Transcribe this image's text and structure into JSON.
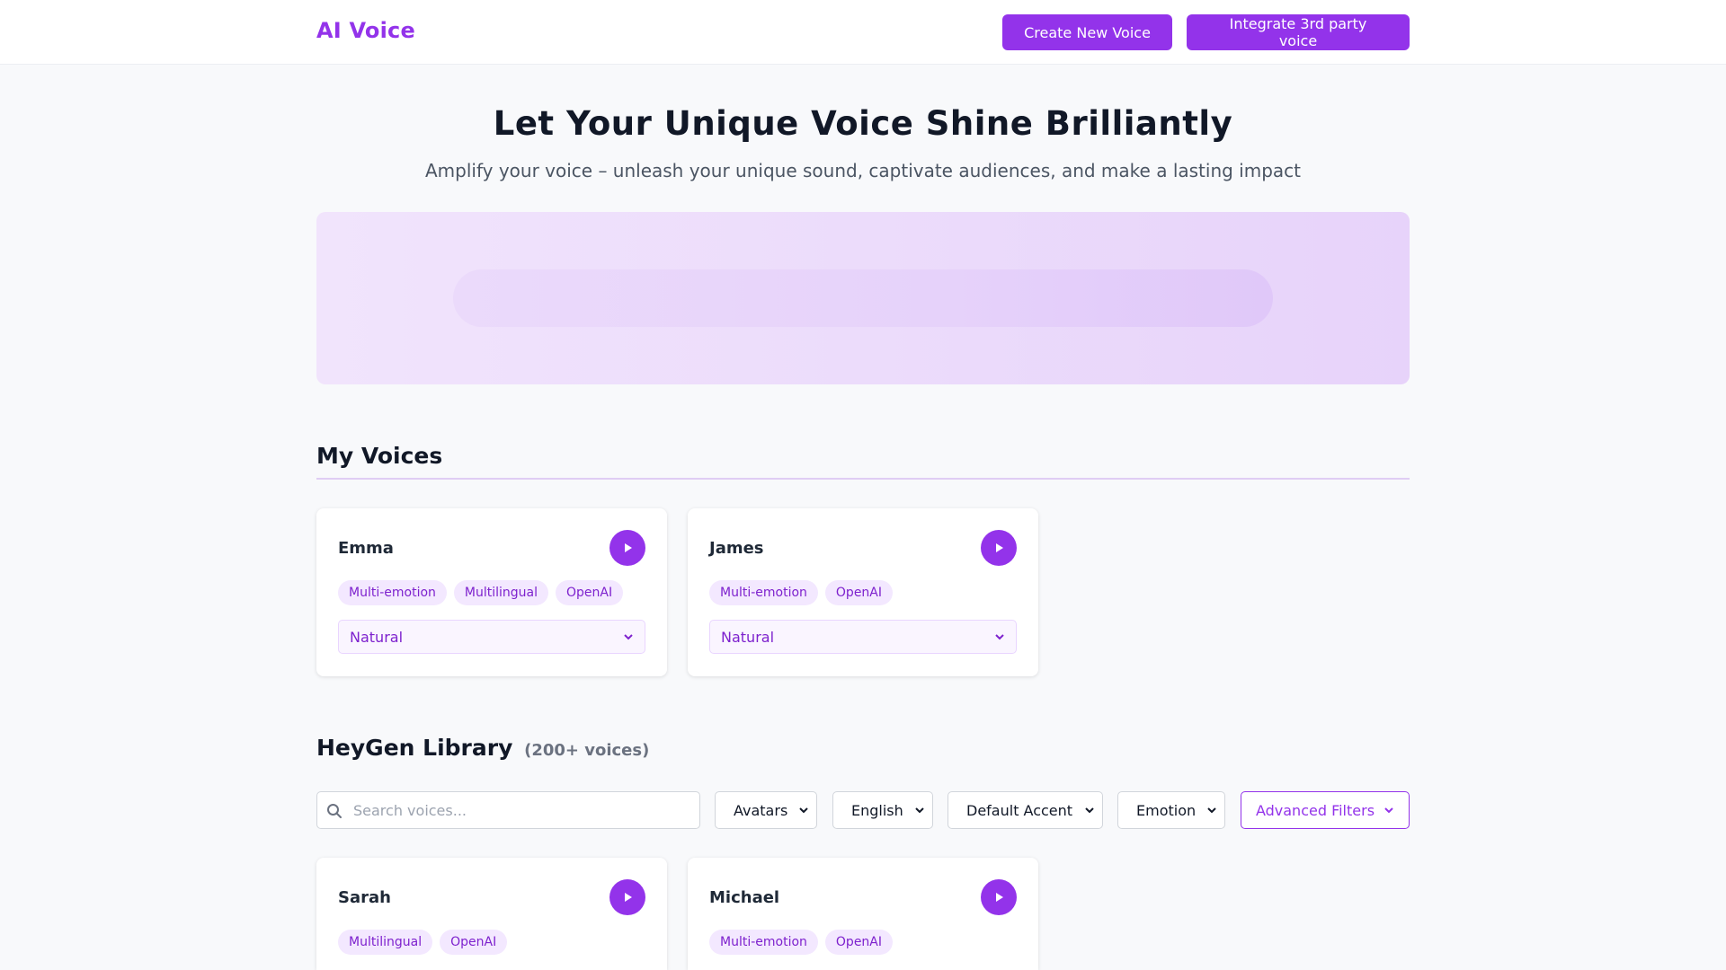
{
  "header": {
    "logo": "AI Voice",
    "create_button": "Create New Voice",
    "integrate_button": "Integrate 3rd party voice"
  },
  "hero": {
    "title": "Let Your Unique Voice Shine Brilliantly",
    "subtitle": "Amplify your voice – unleash your unique sound, captivate audiences, and make a lasting impact"
  },
  "my_voices": {
    "title": "My Voices",
    "cards": [
      {
        "name": "Emma",
        "tags": [
          "Multi-emotion",
          "Multilingual",
          "OpenAI"
        ],
        "style": "Natural"
      },
      {
        "name": "James",
        "tags": [
          "Multi-emotion",
          "OpenAI"
        ],
        "style": "Natural"
      }
    ]
  },
  "library": {
    "title": "HeyGen Library",
    "count": "(200+ voices)",
    "search_placeholder": "Search voices...",
    "filters": {
      "avatars": "Avatars",
      "language": "English",
      "accent": "Default Accent",
      "emotion": "Emotion",
      "advanced": "Advanced Filters"
    },
    "cards": [
      {
        "name": "Sarah",
        "tags": [
          "Multilingual",
          "OpenAI"
        ]
      },
      {
        "name": "Michael",
        "tags": [
          "Multi-emotion",
          "OpenAI"
        ]
      }
    ]
  },
  "colors": {
    "accent": "#9333ea",
    "tag_bg": "#f3e8ff",
    "tag_text": "#7e22ce"
  }
}
